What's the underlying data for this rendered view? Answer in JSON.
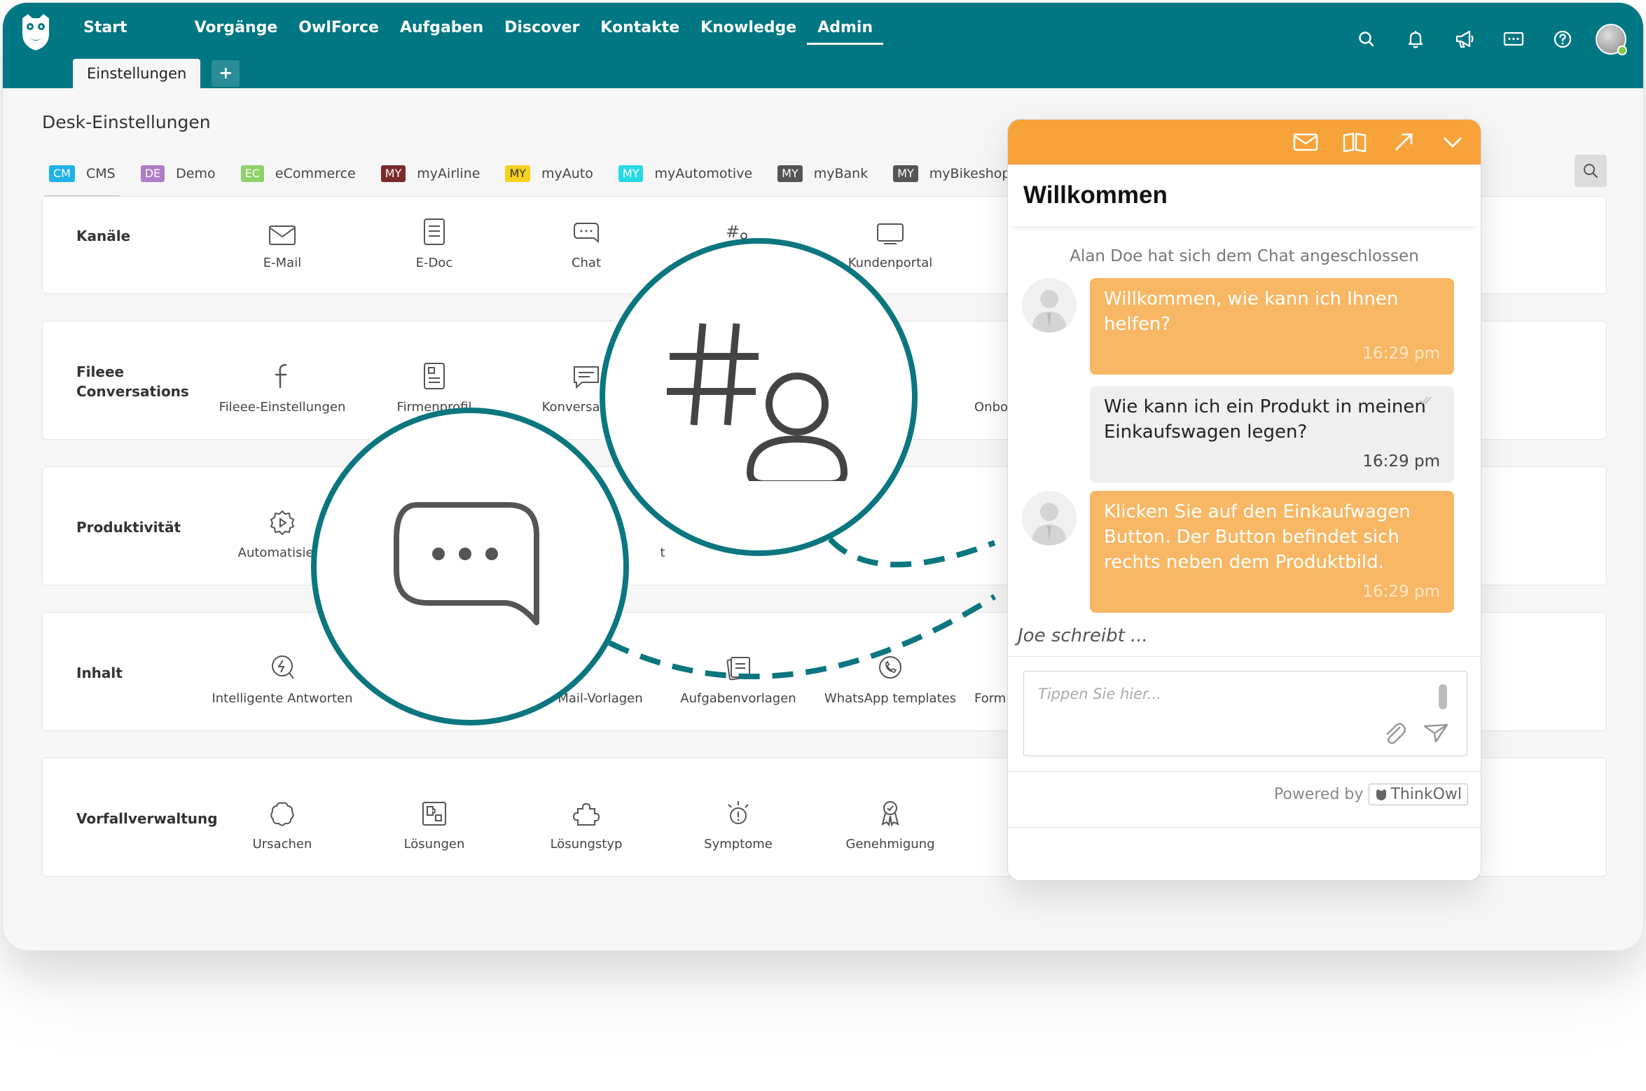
{
  "nav": {
    "items": [
      "Start",
      "Vorgänge",
      "OwlForce",
      "Aufgaben",
      "Discover",
      "Kontakte",
      "Knowledge",
      "Admin"
    ],
    "active": "Admin"
  },
  "tabs": {
    "einstellungen": "Einstellungen",
    "add": "+"
  },
  "page": {
    "title": "Desk-Einstellungen"
  },
  "brands": [
    {
      "code": "CM",
      "name": "CMS",
      "color": "#1fb2e8"
    },
    {
      "code": "DE",
      "name": "Demo",
      "color": "#b07cc6"
    },
    {
      "code": "EC",
      "name": "eCommerce",
      "color": "#8fd16a"
    },
    {
      "code": "MY",
      "name": "myAirline",
      "color": "#7a2a2a"
    },
    {
      "code": "MY",
      "name": "myAuto",
      "color": "#f4d21f"
    },
    {
      "code": "MY",
      "name": "myAutomotive",
      "color": "#27d9e6"
    },
    {
      "code": "MY",
      "name": "myBank",
      "color": "#555555"
    },
    {
      "code": "MY",
      "name": "myBikeshop",
      "color": "#555555"
    }
  ],
  "sections": {
    "kanaele": {
      "title": "Kanäle",
      "items": [
        "E-Mail",
        "E-Doc",
        "Chat",
        "",
        "Kundenportal"
      ]
    },
    "fileee": {
      "title": "Fileee Conversations",
      "items": [
        "Fileee-Einstellungen",
        "Firmenprofil",
        "Konversations",
        "Onbo"
      ]
    },
    "produktivitaet": {
      "title": "Produktivität",
      "items": [
        "Automatisieru",
        "t"
      ]
    },
    "inhalt": {
      "title": "Inhalt",
      "items": [
        "Intelligente Antworten",
        "Mail-Vorlagen",
        "Aufgabenvorlagen",
        "WhatsApp templates",
        "Formu"
      ]
    },
    "vorfall": {
      "title": "Vorfallverwaltung",
      "items": [
        "Ursachen",
        "Lösungen",
        "Lösungstyp",
        "Symptome",
        "Genehmigung"
      ]
    }
  },
  "chat": {
    "title": "Willkommen",
    "joined": "Alan Doe hat sich dem Chat angeschlossen",
    "messages": [
      {
        "text": "Willkommen, wie kann ich Ihnen helfen?",
        "time": "16:29 pm"
      },
      {
        "text": "Wie kann ich ein Produkt in meinen Einkaufswagen legen?",
        "time": "16:29 pm"
      },
      {
        "text": "Klicken Sie auf den Einkaufwagen Button. Der Button befindet sich rechts neben dem Produktbild.",
        "time": "16:29 pm"
      }
    ],
    "typing": "Joe schreibt ...",
    "input_placeholder": "Tippen Sie hier...",
    "powered_by": "Powered by",
    "brand": "ThinkOwl"
  },
  "colors": {
    "teal": "#007783",
    "orange": "#f7a33a",
    "agent_bubble": "#f8b764"
  }
}
